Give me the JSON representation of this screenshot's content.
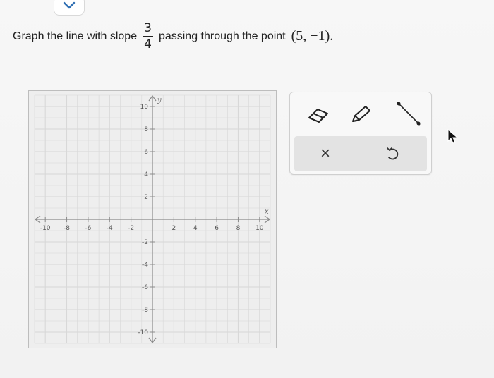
{
  "question": {
    "prefix": "Graph the line with slope",
    "slope_numerator": "3",
    "slope_denominator": "4",
    "middle": "passing through the point",
    "point": "(5, −1)."
  },
  "graph": {
    "x_axis_label": "x",
    "y_axis_label": "y",
    "x_ticks": [
      "-10",
      "-8",
      "-6",
      "-4",
      "-2",
      "2",
      "4",
      "6",
      "8",
      "10"
    ],
    "y_ticks": [
      "10",
      "8",
      "6",
      "4",
      "2",
      "-2",
      "-4",
      "-6",
      "-8",
      "-10"
    ],
    "x_range": [
      -11,
      11
    ],
    "y_range": [
      -11,
      11
    ],
    "grid": true
  },
  "toolbox": {
    "tools": [
      "eraser-icon",
      "pencil-icon",
      "line-segment-icon"
    ],
    "actions": [
      "clear-icon",
      "undo-icon"
    ],
    "clear_symbol": "×"
  },
  "colors": {
    "grid_line": "#d7d7d7",
    "axis_line": "#8a8a8a",
    "tick_label": "#555555"
  }
}
